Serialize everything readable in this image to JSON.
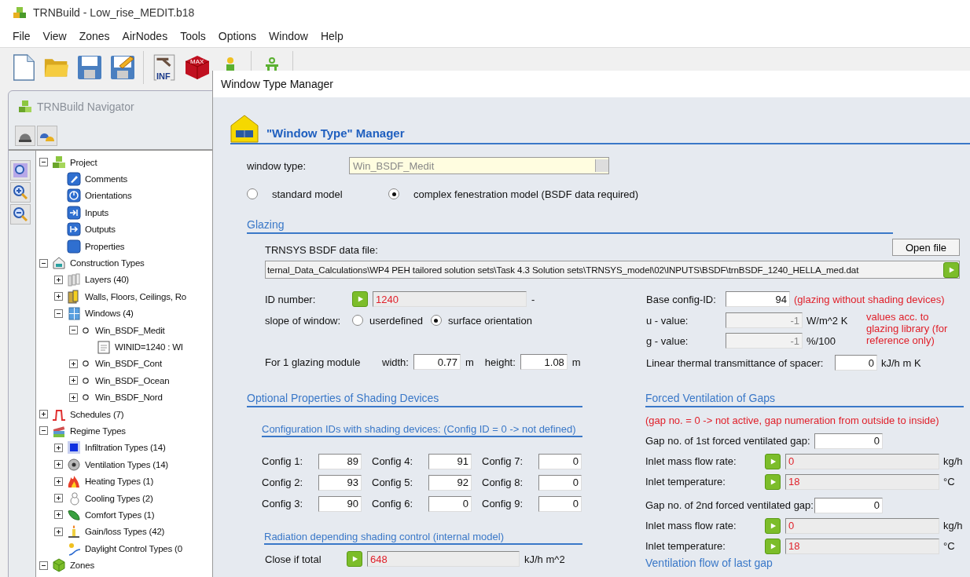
{
  "app_title": "TRNBuild - Low_rise_MEDIT.b18",
  "menu": [
    "File",
    "View",
    "Zones",
    "AirNodes",
    "Tools",
    "Options",
    "Window",
    "Help"
  ],
  "toolbar": [
    [
      {
        "kind": "new"
      },
      {
        "kind": "open"
      },
      {
        "kind": "save"
      },
      {
        "kind": "save-edit"
      }
    ],
    [
      {
        "kind": "inf",
        "label": "INF"
      },
      {
        "kind": "max",
        "label": "MAX"
      },
      {
        "kind": "person"
      }
    ],
    [
      {
        "kind": "figure"
      }
    ]
  ],
  "navigator": {
    "title": "TRNBuild Navigator",
    "tools": [
      {
        "kind": "helmet"
      },
      {
        "kind": "helmets"
      }
    ],
    "side_tools": [
      {
        "kind": "zoom-fit"
      },
      {
        "kind": "zoom-in"
      },
      {
        "kind": "zoom-out"
      }
    ],
    "tree": [
      {
        "label": "Project",
        "kind": "project",
        "expanded": true,
        "children": [
          {
            "label": "Comments",
            "kind": "comments"
          },
          {
            "label": "Orientations",
            "kind": "orientations"
          },
          {
            "label": "Inputs",
            "kind": "inputs"
          },
          {
            "label": "Outputs",
            "kind": "outputs"
          },
          {
            "label": "Properties",
            "kind": "properties"
          }
        ]
      },
      {
        "label": "Construction Types",
        "kind": "house",
        "expanded": true,
        "children": [
          {
            "label": "Layers (40)",
            "kind": "layers",
            "expanded": false
          },
          {
            "label": "Walls, Floors, Ceilings, Ro",
            "kind": "walls",
            "expanded": false
          },
          {
            "label": "Windows (4)",
            "kind": "windows",
            "expanded": true,
            "children": [
              {
                "label": "Win_BSDF_Medit",
                "kind": "circle",
                "expanded": true,
                "children": [
                  {
                    "label": "WINID=1240 : WI",
                    "kind": "note"
                  }
                ]
              },
              {
                "label": "Win_BSDF_Cont",
                "kind": "circle",
                "expanded": false
              },
              {
                "label": "Win_BSDF_Ocean",
                "kind": "circle",
                "expanded": false
              },
              {
                "label": "Win_BSDF_Nord",
                "kind": "circle",
                "expanded": false
              }
            ]
          }
        ]
      },
      {
        "label": "Schedules (7)",
        "kind": "schedule",
        "expanded": false
      },
      {
        "label": "Regime Types",
        "kind": "regime",
        "expanded": true,
        "children": [
          {
            "label": "Infiltration Types (14)",
            "kind": "infiltration",
            "expanded": false
          },
          {
            "label": "Ventilation Types (14)",
            "kind": "ventilation",
            "expanded": false
          },
          {
            "label": "Heating Types (1)",
            "kind": "heating",
            "expanded": false
          },
          {
            "label": "Cooling Types (2)",
            "kind": "cooling",
            "expanded": false
          },
          {
            "label": "Comfort Types (1)",
            "kind": "comfort",
            "expanded": false
          },
          {
            "label": "Gain/loss Types (42)",
            "kind": "gainloss",
            "expanded": false
          },
          {
            "label": "Daylight Control Types (0",
            "kind": "daylight"
          }
        ]
      },
      {
        "label": "Zones",
        "kind": "zone",
        "expanded": true
      }
    ]
  },
  "dialog": {
    "title": "Window Type Manager",
    "heading": "\"Window Type\" Manager",
    "window_type": {
      "label": "window type:",
      "value": "Win_BSDF_Medit"
    },
    "models": [
      {
        "label": "standard model",
        "selected": false
      },
      {
        "label": "complex fenestration model (BSDF data required)",
        "selected": true
      }
    ],
    "glazing": {
      "title": "Glazing",
      "file_label": "TRNSYS BSDF data file:",
      "open_button": "Open file",
      "file_path": "ternal_Data_Calculations\\WP4 PEH tailored solution sets\\Task 4.3 Solution sets\\TRNSYS_model\\02\\INPUTS\\BSDF\\trnBSDF_1240_HELLA_med.dat",
      "id_label": "ID number:",
      "id_value": "1240",
      "id_unit": "-",
      "slope_label": "slope of window:",
      "slope_options": [
        {
          "label": "userdefined",
          "selected": false
        },
        {
          "label": "surface orientation",
          "selected": true
        }
      ],
      "module_label": "For 1 glazing module",
      "width_label": "width:",
      "width_value": "0.77",
      "width_unit": "m",
      "height_label": "height:",
      "height_value": "1.08",
      "height_unit": "m",
      "base_label": "Base config-ID:",
      "base_value": "94",
      "base_note": "(glazing without shading devices)",
      "u_label": "u - value:",
      "u_value": "-1",
      "u_unit": "W/m^2 K",
      "g_label": "g - value:",
      "g_value": "-1",
      "g_unit": "%/100",
      "library_note": "values acc. to glazing library (for reference only)",
      "spacer_label": "Linear thermal transmittance of spacer:",
      "spacer_value": "0",
      "spacer_unit": "kJ/h m K"
    },
    "shading": {
      "title": "Optional Properties of Shading Devices",
      "config_title": "Configuration IDs with shading devices: (Config ID = 0 -> not defined)",
      "configs": [
        {
          "label": "Config 1:",
          "value": "89"
        },
        {
          "label": "Config 2:",
          "value": "93"
        },
        {
          "label": "Config 3:",
          "value": "90"
        },
        {
          "label": "Config 4:",
          "value": "91"
        },
        {
          "label": "Config 5:",
          "value": "92"
        },
        {
          "label": "Config 6:",
          "value": "0"
        },
        {
          "label": "Config 7:",
          "value": "0"
        },
        {
          "label": "Config 8:",
          "value": "0"
        },
        {
          "label": "Config 9:",
          "value": "0"
        }
      ],
      "radiation_title": "Radiation depending shading control (internal model)",
      "close_label": "Close if total",
      "close_value": "648",
      "close_unit": "kJ/h m^2"
    },
    "ventilation": {
      "title": "Forced Ventilation of Gaps",
      "note": "(gap no. = 0 -> not active, gap numeration from outside to inside)",
      "gaps": [
        {
          "label": "Gap no. of 1st forced ventilated gap:",
          "value": "0",
          "flow_label": "Inlet mass flow rate:",
          "flow_value": "0",
          "flow_unit": "kg/h",
          "temp_label": "Inlet temperature:",
          "temp_value": "18",
          "temp_unit": "°C"
        },
        {
          "label": "Gap no. of 2nd forced ventilated gap:",
          "value": "0",
          "flow_label": "Inlet mass flow rate:",
          "flow_value": "0",
          "flow_unit": "kg/h",
          "temp_label": "Inlet temperature:",
          "temp_value": "18",
          "temp_unit": "°C"
        }
      ],
      "last_title": "Ventilation flow of last gap"
    }
  }
}
